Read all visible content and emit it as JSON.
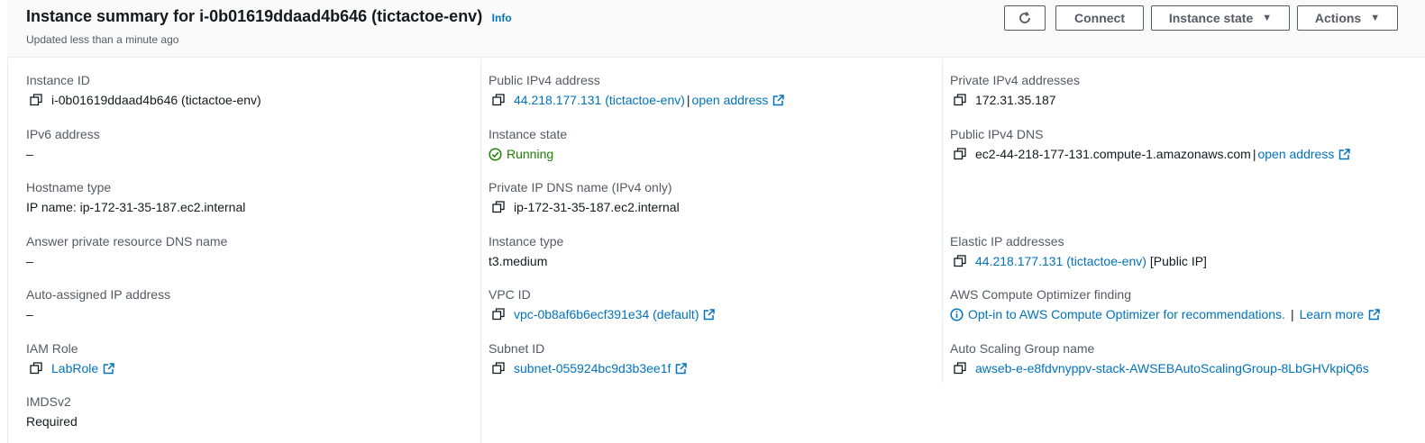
{
  "header": {
    "title": "Instance summary for i-0b01619ddaad4b646 (tictactoe-env)",
    "info_label": "Info",
    "subtitle": "Updated less than a minute ago",
    "connect_label": "Connect",
    "instance_state_label": "Instance state",
    "actions_label": "Actions"
  },
  "col1": {
    "instance_id": {
      "label": "Instance ID",
      "value": "i-0b01619ddaad4b646 (tictactoe-env)"
    },
    "ipv6": {
      "label": "IPv6 address",
      "value": "–"
    },
    "hostname_type": {
      "label": "Hostname type",
      "value": "IP name: ip-172-31-35-187.ec2.internal"
    },
    "answer_dns": {
      "label": "Answer private resource DNS name",
      "value": "–"
    },
    "auto_ip": {
      "label": "Auto-assigned IP address",
      "value": "–"
    },
    "iam_role": {
      "label": "IAM Role",
      "value": "LabRole"
    },
    "imdsv2": {
      "label": "IMDSv2",
      "value": "Required"
    }
  },
  "col2": {
    "public_ipv4": {
      "label": "Public IPv4 address",
      "value": "44.218.177.131 (tictactoe-env)",
      "sep": "|",
      "open": "open address"
    },
    "instance_state": {
      "label": "Instance state",
      "value": "Running"
    },
    "private_dns": {
      "label": "Private IP DNS name (IPv4 only)",
      "value": "ip-172-31-35-187.ec2.internal"
    },
    "instance_type": {
      "label": "Instance type",
      "value": "t3.medium"
    },
    "vpc": {
      "label": "VPC ID",
      "value": "vpc-0b8af6b6ecf391e34 (default)"
    },
    "subnet": {
      "label": "Subnet ID",
      "value": "subnet-055924bc9d3b3ee1f"
    }
  },
  "col3": {
    "private_ipv4": {
      "label": "Private IPv4 addresses",
      "value": "172.31.35.187"
    },
    "public_dns": {
      "label": "Public IPv4 DNS",
      "value": "ec2-44-218-177-131.compute-1.amazonaws.com",
      "sep": "|",
      "open": "open address"
    },
    "elastic_ip": {
      "label": "Elastic IP addresses",
      "value": "44.218.177.131 (tictactoe-env)",
      "suffix": "[Public IP]"
    },
    "optimizer": {
      "label": "AWS Compute Optimizer finding",
      "value": "Opt-in to AWS Compute Optimizer for recommendations.",
      "sep": "|",
      "learn": "Learn more"
    },
    "asg": {
      "label": "Auto Scaling Group name",
      "value": "awseb-e-e8fdvnyppv-stack-AWSEBAutoScalingGroup-8LbGHVkpiQ6s"
    }
  },
  "colors": {
    "link": "#0073bb",
    "running": "#1d8102",
    "text": "#16191f",
    "label": "#545b64"
  }
}
